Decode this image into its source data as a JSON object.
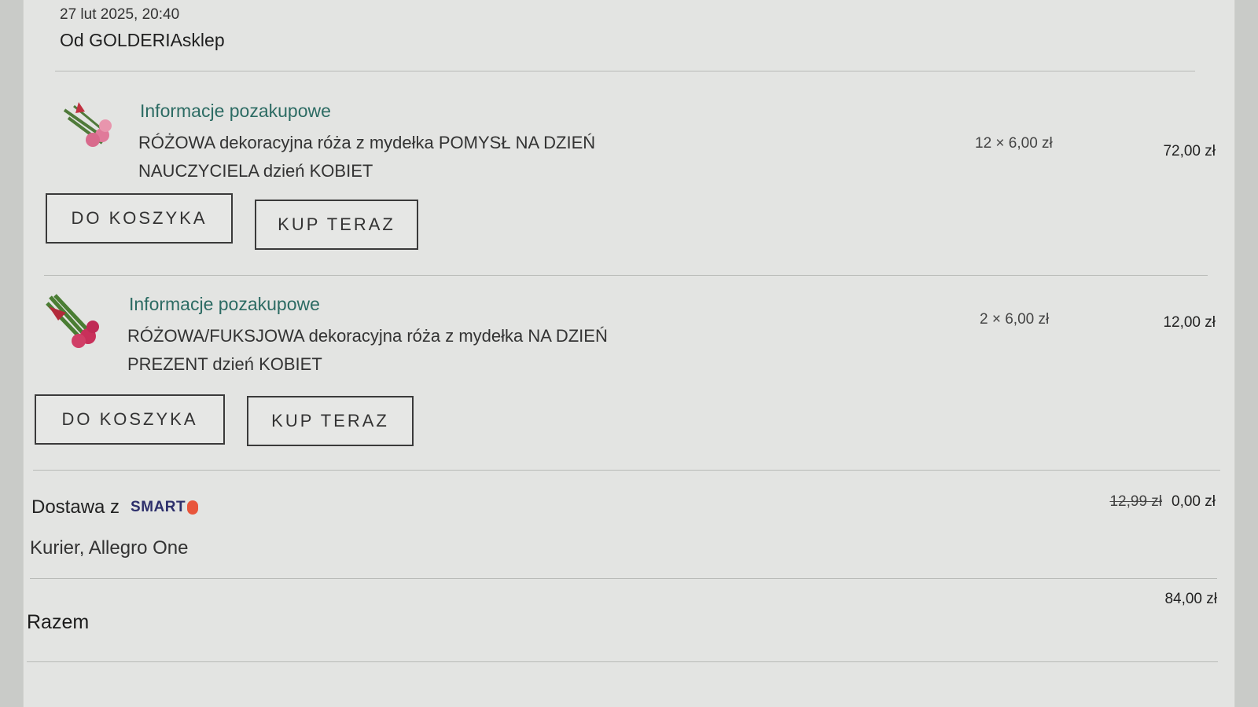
{
  "order": {
    "date": "27 lut 2025, 20:40",
    "seller": "Od GOLDERIAsklep"
  },
  "items": [
    {
      "info_label": "Informacje pozakupowe",
      "title": "RÓŻOWA dekoracyjna róża z mydełka POMYSŁ NA DZIEŃ NAUCZYCIELA dzień KOBIET",
      "quantity_price": "12 × 6,00 zł",
      "total": "72,00 zł",
      "cart_button": "DO KOSZYKA",
      "buy_button": "KUP TERAZ",
      "thumbnail_icon": "pink-rose-bouquet-icon"
    },
    {
      "info_label": "Informacje pozakupowe",
      "title": "RÓŻOWA/FUKSJOWA dekoracyjna róża z mydełka NA DZIEŃ PREZENT dzień KOBIET",
      "quantity_price": "2 × 6,00 zł",
      "total": "12,00 zł",
      "cart_button": "DO KOSZYKA",
      "buy_button": "KUP TERAZ",
      "thumbnail_icon": "fuchsia-rose-bouquet-icon"
    }
  ],
  "delivery": {
    "label": "Dostawa z",
    "badge": "SMART",
    "method": "Kurier, Allegro One",
    "old_price": "12,99 zł",
    "price": "0,00 zł"
  },
  "summary": {
    "label": "Razem",
    "total": "84,00 zł"
  },
  "colors": {
    "accent_teal": "#2c6b63",
    "smart_navy": "#2d2f6b",
    "smart_orange": "#e8553b"
  }
}
